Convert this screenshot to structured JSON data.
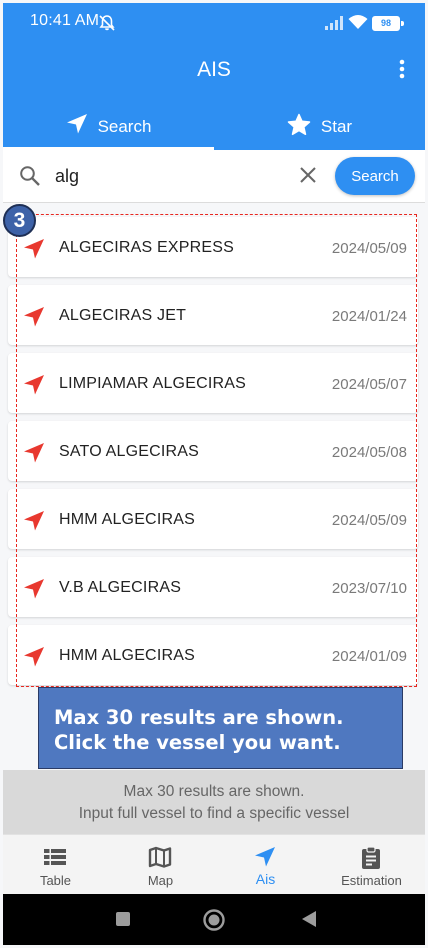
{
  "status_bar": {
    "time": "10:41 AM",
    "battery": "98"
  },
  "app_bar": {
    "title": "AIS",
    "tabs": [
      {
        "label": "Search",
        "icon": "navigation-arrow-icon",
        "active": true
      },
      {
        "label": "Star",
        "icon": "star-icon",
        "active": false
      }
    ]
  },
  "search": {
    "value": "alg",
    "button_label": "Search"
  },
  "results": [
    {
      "name": "ALGECIRAS EXPRESS",
      "date": "2024/05/09"
    },
    {
      "name": "ALGECIRAS JET",
      "date": "2024/01/24"
    },
    {
      "name": "LIMPIAMAR ALGECIRAS",
      "date": "2024/05/07"
    },
    {
      "name": "SATO ALGECIRAS",
      "date": "2024/05/08"
    },
    {
      "name": "HMM ALGECIRAS",
      "date": "2024/05/09"
    },
    {
      "name": "V.B ALGECIRAS",
      "date": "2023/07/10"
    },
    {
      "name": "HMM ALGECIRAS",
      "date": "2024/01/09"
    }
  ],
  "annotation": {
    "step": "3",
    "callout_line1": "Max 30 results are shown.",
    "callout_line2": "Click the vessel you want."
  },
  "footer": {
    "line1": "Max 30 results are shown.",
    "line2": "Input full vessel to find a specific vessel"
  },
  "bottom_nav": [
    {
      "label": "Table",
      "icon": "table-icon",
      "active": false
    },
    {
      "label": "Map",
      "icon": "map-icon",
      "active": false
    },
    {
      "label": "Ais",
      "icon": "navigation-arrow-icon",
      "active": true
    },
    {
      "label": "Estimation",
      "icon": "clipboard-icon",
      "active": false
    }
  ],
  "colors": {
    "primary": "#2e8ff2",
    "vessel_arrow": "#e8382f",
    "annotation_dash": "#e8271f",
    "callout_bg": "#4f78c0"
  }
}
